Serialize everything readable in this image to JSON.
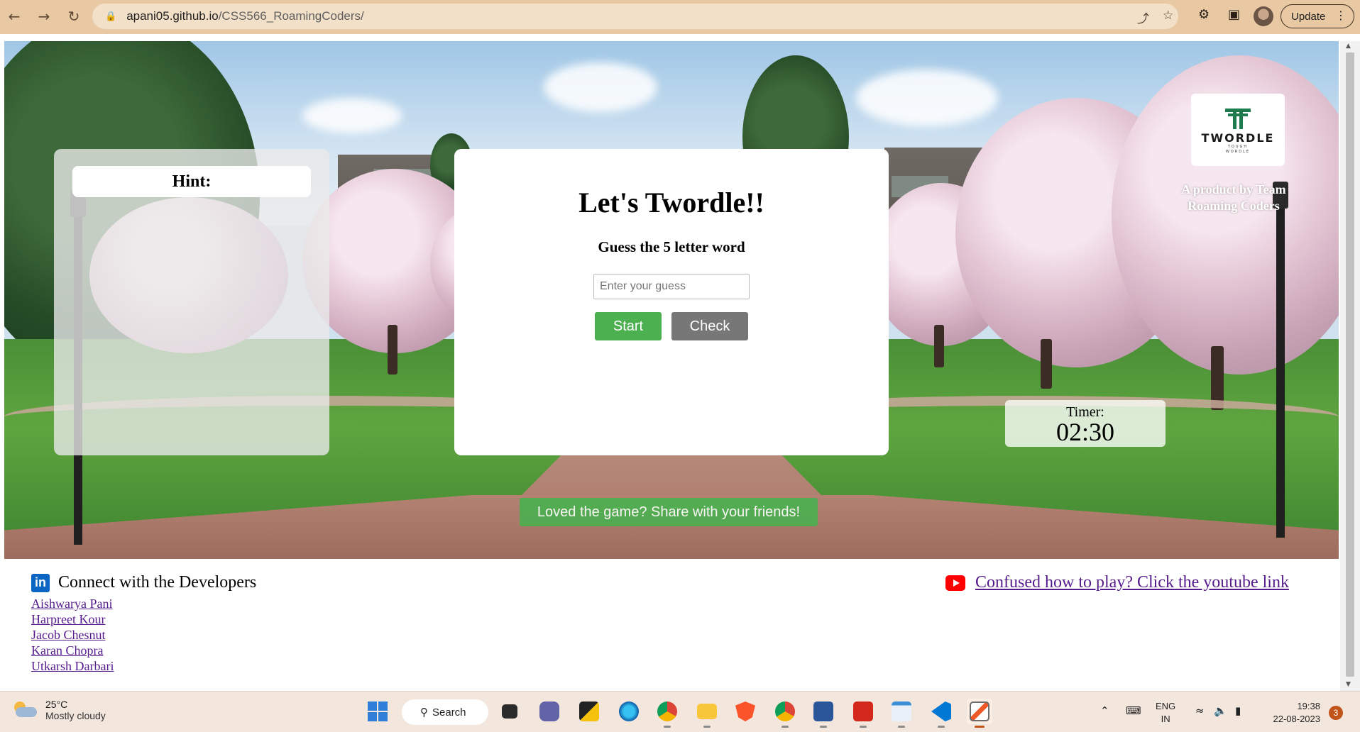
{
  "browser": {
    "url_host": "apani05.github.io",
    "url_path": "/CSS566_RoamingCoders/",
    "update_label": "Update"
  },
  "hint": {
    "title": "Hint:"
  },
  "game": {
    "title": "Let's Twordle!!",
    "subtitle": "Guess the 5 letter word",
    "guess_placeholder": "Enter your guess",
    "guess_value": "",
    "start_label": "Start",
    "check_label": "Check"
  },
  "brand": {
    "wordmark": "TWORDLE",
    "tagline_line1": "TOUGH",
    "tagline_line2": "WORDLE",
    "product_by": "A product by Team Roaming Coders"
  },
  "timer": {
    "label": "Timer:",
    "value": "02:30"
  },
  "share": {
    "label": "Loved the game? Share with your friends!"
  },
  "footer": {
    "connect_title": "Connect with the Developers",
    "linkedin_glyph": "in",
    "developers": [
      "Aishwarya Pani",
      "Harpreet Kour",
      "Jacob Chesnut",
      "Karan Chopra",
      "Utkarsh Darbari"
    ],
    "youtube_link": "Confused how to play? Click the youtube link"
  },
  "taskbar": {
    "temperature": "25°C",
    "condition": "Mostly cloudy",
    "search_label": "Search",
    "lang_line1": "ENG",
    "lang_line2": "IN",
    "time": "19:38",
    "date": "22-08-2023",
    "notification_count": "3"
  },
  "colors": {
    "start_green": "#4caf50",
    "check_gray": "#777777",
    "link_purple": "#551a8b",
    "linkedin_blue": "#0a66c2",
    "youtube_red": "#ff0000",
    "brand_green": "#1f7a4e"
  }
}
